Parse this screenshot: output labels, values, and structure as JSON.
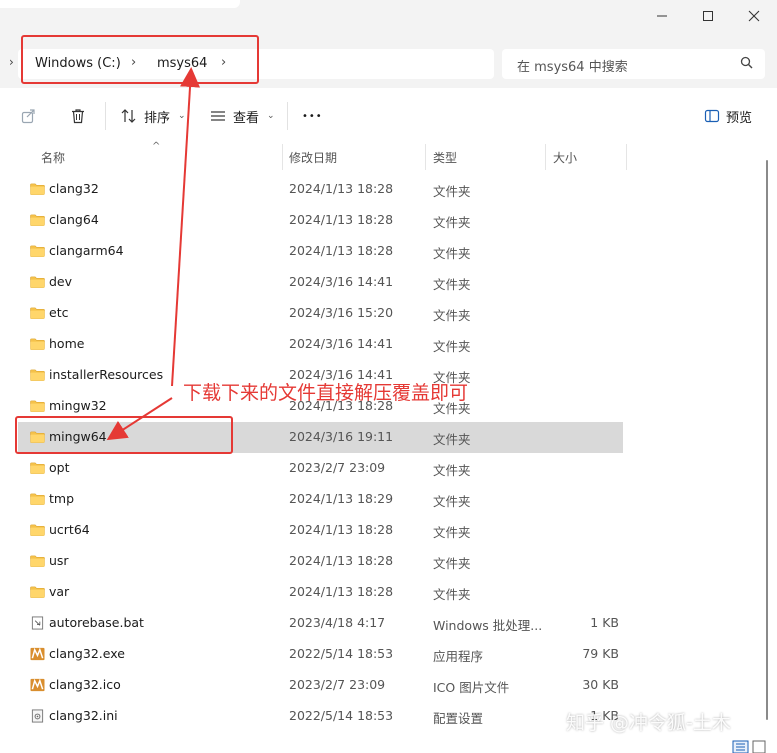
{
  "breadcrumb": {
    "items": [
      "Windows (C:)",
      "msys64"
    ]
  },
  "search": {
    "placeholder": "在 msys64 中搜索"
  },
  "toolbar": {
    "sort_label": "排序",
    "view_label": "查看",
    "more_label": "•••",
    "preview_label": "预览"
  },
  "columns": {
    "name": "名称",
    "date": "修改日期",
    "type": "类型",
    "size": "大小"
  },
  "files": [
    {
      "name": "clang32",
      "date": "2024/1/13 18:28",
      "type": "文件夹",
      "size": "",
      "icon": "folder-icon"
    },
    {
      "name": "clang64",
      "date": "2024/1/13 18:28",
      "type": "文件夹",
      "size": "",
      "icon": "folder-icon"
    },
    {
      "name": "clangarm64",
      "date": "2024/1/13 18:28",
      "type": "文件夹",
      "size": "",
      "icon": "folder-icon"
    },
    {
      "name": "dev",
      "date": "2024/3/16 14:41",
      "type": "文件夹",
      "size": "",
      "icon": "folder-icon"
    },
    {
      "name": "etc",
      "date": "2024/3/16 15:20",
      "type": "文件夹",
      "size": "",
      "icon": "folder-icon"
    },
    {
      "name": "home",
      "date": "2024/3/16 14:41",
      "type": "文件夹",
      "size": "",
      "icon": "folder-icon"
    },
    {
      "name": "installerResources",
      "date": "2024/3/16 14:41",
      "type": "文件夹",
      "size": "",
      "icon": "folder-icon"
    },
    {
      "name": "mingw32",
      "date": "2024/1/13 18:28",
      "type": "文件夹",
      "size": "",
      "icon": "folder-icon"
    },
    {
      "name": "mingw64",
      "date": "2024/3/16 19:11",
      "type": "文件夹",
      "size": "",
      "icon": "folder-icon"
    },
    {
      "name": "opt",
      "date": "2023/2/7 23:09",
      "type": "文件夹",
      "size": "",
      "icon": "folder-icon"
    },
    {
      "name": "tmp",
      "date": "2024/1/13 18:29",
      "type": "文件夹",
      "size": "",
      "icon": "folder-icon"
    },
    {
      "name": "ucrt64",
      "date": "2024/1/13 18:28",
      "type": "文件夹",
      "size": "",
      "icon": "folder-icon"
    },
    {
      "name": "usr",
      "date": "2024/1/13 18:28",
      "type": "文件夹",
      "size": "",
      "icon": "folder-icon"
    },
    {
      "name": "var",
      "date": "2024/1/13 18:28",
      "type": "文件夹",
      "size": "",
      "icon": "folder-icon"
    },
    {
      "name": "autorebase.bat",
      "date": "2023/4/18 4:17",
      "type": "Windows 批处理...",
      "size": "1 KB",
      "icon": "batch-file-icon"
    },
    {
      "name": "clang32.exe",
      "date": "2022/5/14 18:53",
      "type": "应用程序",
      "size": "79 KB",
      "icon": "msys-app-icon"
    },
    {
      "name": "clang32.ico",
      "date": "2023/2/7 23:09",
      "type": "ICO 图片文件",
      "size": "30 KB",
      "icon": "msys-app-icon"
    },
    {
      "name": "clang32.ini",
      "date": "2022/5/14 18:53",
      "type": "配置设置",
      "size": "1 KB",
      "icon": "ini-file-icon"
    }
  ],
  "selected_row": 8,
  "annotation": {
    "text": "下载下来的文件直接解压覆盖即可"
  },
  "watermark": "知乎 @冲令狐-土木",
  "colors": {
    "annotation_red": "#e53935",
    "folder_yellow": "#f5c24b",
    "selection_gray": "#d9d9d9",
    "chrome_gray": "#f3f3f3"
  }
}
